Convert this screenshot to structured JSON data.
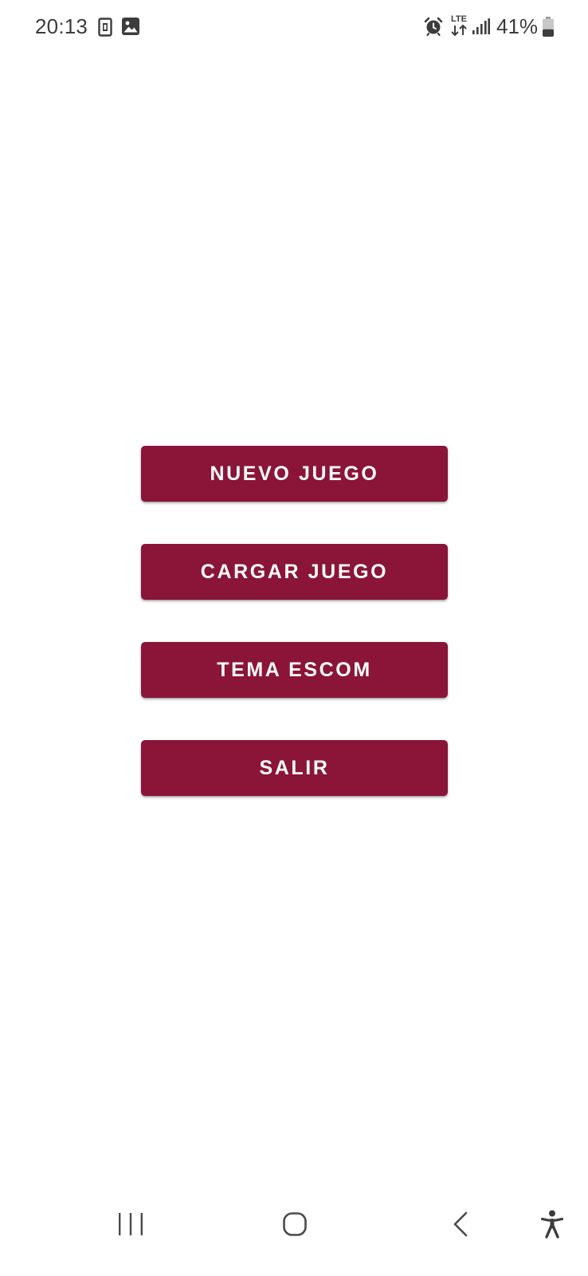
{
  "status_bar": {
    "time": "20:13",
    "left_icons": [
      "sim-card-icon",
      "gallery-icon"
    ],
    "right_icons": [
      "alarm-icon",
      "lte-data-icon",
      "signal-bars-icon",
      "battery-icon"
    ],
    "network_label": "LTE",
    "battery_percent": "41%",
    "battery_level": 0.41
  },
  "menu": {
    "accent_color": "#8a1538",
    "items": [
      {
        "label": "NUEVO JUEGO"
      },
      {
        "label": "CARGAR JUEGO"
      },
      {
        "label": "TEMA ESCOM"
      },
      {
        "label": "SALIR"
      }
    ]
  },
  "nav_bar": {
    "buttons": [
      "recents-icon",
      "home-icon",
      "back-icon",
      "accessibility-icon"
    ]
  }
}
